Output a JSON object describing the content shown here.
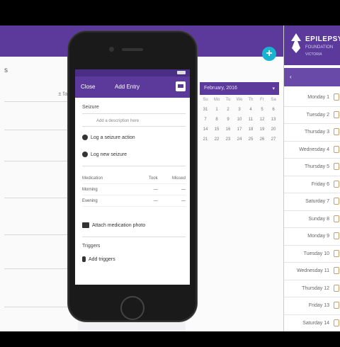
{
  "colors": {
    "primary": "#5b3a9c",
    "accent": "#17b3cf"
  },
  "background_form": {
    "header": "s",
    "rows": [
      {
        "value": "±  fa ±"
      },
      {
        "value": ""
      },
      {
        "value": "±"
      },
      {
        "value": "*"
      },
      {
        "value": "±"
      },
      {
        "value": "±"
      },
      {
        "value": "⊕"
      }
    ]
  },
  "calendar": {
    "month": "February, 2016",
    "weekdays": [
      "Su",
      "Mo",
      "Tu",
      "We",
      "Th",
      "Fr",
      "Sa"
    ],
    "weeks": [
      [
        "31",
        "1",
        "2",
        "3",
        "4",
        "5",
        "6"
      ],
      [
        "7",
        "8",
        "9",
        "10",
        "11",
        "12",
        "13"
      ],
      [
        "14",
        "15",
        "16",
        "17",
        "18",
        "19",
        "20"
      ],
      [
        "21",
        "22",
        "23",
        "24",
        "25",
        "26",
        "27"
      ]
    ]
  },
  "fab_icon": "add-icon",
  "brand": {
    "name": "EPILEPSY",
    "sub": "FOUNDATION",
    "sub2": "VICTORIA"
  },
  "right_panel": {
    "bar_label": "‹",
    "days": [
      "Monday 1",
      "Tuesday 2",
      "Thursday 3",
      "Wednesday 4",
      "Thursday 5",
      "Friday 6",
      "Saturday 7",
      "Sunday 8",
      "Monday 9",
      "Tuesday 10",
      "Wednesday 11",
      "Thursday 12",
      "Friday 13",
      "Saturday 14"
    ]
  },
  "phone": {
    "appbar": {
      "close": "Close",
      "title": "Add Entry"
    },
    "section1_label": "Seizure",
    "section1_note": "Add a description here",
    "add_auto": "Log a seizure action",
    "add_manual": "Log new seizure",
    "table": {
      "headers": [
        "Medication",
        "Took",
        "Missed"
      ],
      "rows": [
        {
          "name": "Morning",
          "took": "—",
          "missed": "—"
        },
        {
          "name": "Evening",
          "took": "—",
          "missed": "—"
        }
      ]
    },
    "photo_label": "Attach medication photo",
    "triggers_label": "Triggers",
    "triggers_item": "Add triggers"
  }
}
